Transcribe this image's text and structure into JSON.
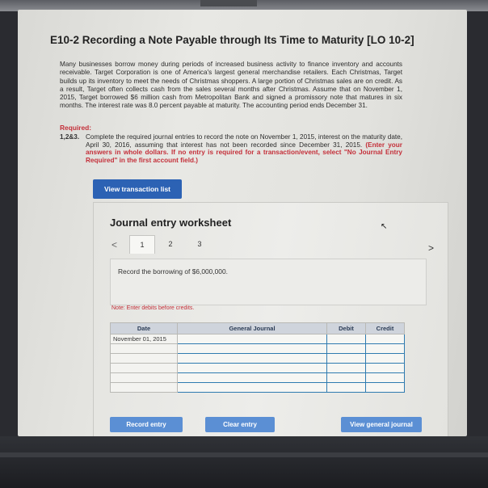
{
  "title": "E10-2 Recording a Note Payable through Its Time to Maturity [LO 10-2]",
  "intro": "Many businesses borrow money during periods of increased business activity to finance inventory and accounts receivable. Target Corporation is one of America's largest general merchandise retailers. Each Christmas, Target builds up its inventory to meet the needs of Christmas shoppers. A large portion of Christmas sales are on credit. As a result, Target often collects cash from the sales several months after Christmas. Assume that on November 1, 2015, Target borrowed $6 million cash from Metropolitan Bank and signed a promissory note that matures in six months. The interest rate was 8.0 percent payable at maturity. The accounting period ends December 31.",
  "required": {
    "heading": "Required:",
    "number": "1,2&3.",
    "text": "Complete the required journal entries to record the note on November 1, 2015, interest on the maturity date, April 30, 2016, assuming that interest has not been recorded since December 31, 2015.",
    "highlight": "(Enter your answers in whole dollars. If no entry is required for a transaction/event, select \"No Journal Entry Required\" in the first account field.)"
  },
  "view_transaction_list": "View transaction list",
  "worksheet": {
    "title": "Journal entry worksheet",
    "prev": "<",
    "next": ">",
    "tabs": [
      "1",
      "2",
      "3"
    ],
    "instruction": "Record the borrowing of $6,000,000.",
    "note": "Note: Enter debits before credits.",
    "columns": {
      "date": "Date",
      "general_journal": "General Journal",
      "debit": "Debit",
      "credit": "Credit"
    },
    "rows": [
      {
        "date": "November 01, 2015",
        "account": "",
        "debit": "",
        "credit": ""
      },
      {
        "date": "",
        "account": "",
        "debit": "",
        "credit": ""
      },
      {
        "date": "",
        "account": "",
        "debit": "",
        "credit": ""
      },
      {
        "date": "",
        "account": "",
        "debit": "",
        "credit": ""
      },
      {
        "date": "",
        "account": "",
        "debit": "",
        "credit": ""
      },
      {
        "date": "",
        "account": "",
        "debit": "",
        "credit": ""
      }
    ],
    "buttons": {
      "record": "Record entry",
      "clear": "Clear entry",
      "view_gj": "View general journal"
    }
  }
}
